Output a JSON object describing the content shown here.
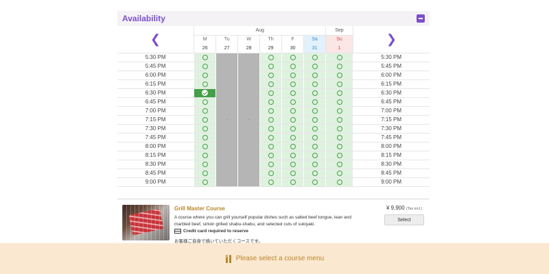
{
  "availability": {
    "title": "Availability"
  },
  "months": {
    "aug": "Aug",
    "sep": "Sep"
  },
  "days": [
    {
      "dow": "M",
      "date": "26",
      "type": "normal",
      "state": "open"
    },
    {
      "dow": "Tu",
      "date": "27",
      "type": "normal",
      "state": "closed"
    },
    {
      "dow": "W",
      "date": "28",
      "type": "normal",
      "state": "closed"
    },
    {
      "dow": "Th",
      "date": "29",
      "type": "normal",
      "state": "open"
    },
    {
      "dow": "F",
      "date": "30",
      "type": "normal",
      "state": "open"
    },
    {
      "dow": "Sa",
      "date": "31",
      "type": "sat",
      "state": "open"
    },
    {
      "dow": "Su",
      "date": "1",
      "type": "sun",
      "state": "open"
    }
  ],
  "times": [
    "5:30 PM",
    "5:45 PM",
    "6:00 PM",
    "6:15 PM",
    "6:30 PM",
    "6:45 PM",
    "7:00 PM",
    "7:15 PM",
    "7:30 PM",
    "7:45 PM",
    "8:00 PM",
    "8:15 PM",
    "8:30 PM",
    "8:45 PM",
    "9:00 PM"
  ],
  "selected_slot": {
    "day": "26",
    "time": "6:30 PM"
  },
  "closed_marker": "-",
  "course": {
    "name": "Grill Master Course",
    "description": "A course where you can grill yourself popular dishes such as salted beef tongue, lean and marbled beef, sirloin grilled shabu-shabu, and selected cuts of sukiyaki.",
    "card_note": "Credit card required to reserve",
    "jp_note": "お客様ご自身で焼いていただくコースです。",
    "price": "¥ 9,900",
    "tax_note": "(Tax incl.)",
    "select_label": "Select"
  },
  "footer": {
    "message": "Please select a course menu"
  },
  "colors": {
    "accent": "#7b4fc9",
    "available": "#dff1df",
    "selected": "#43a047",
    "closed": "#b5b5b5",
    "footer_bg": "#fbe8d0",
    "gold": "#b8862b"
  }
}
